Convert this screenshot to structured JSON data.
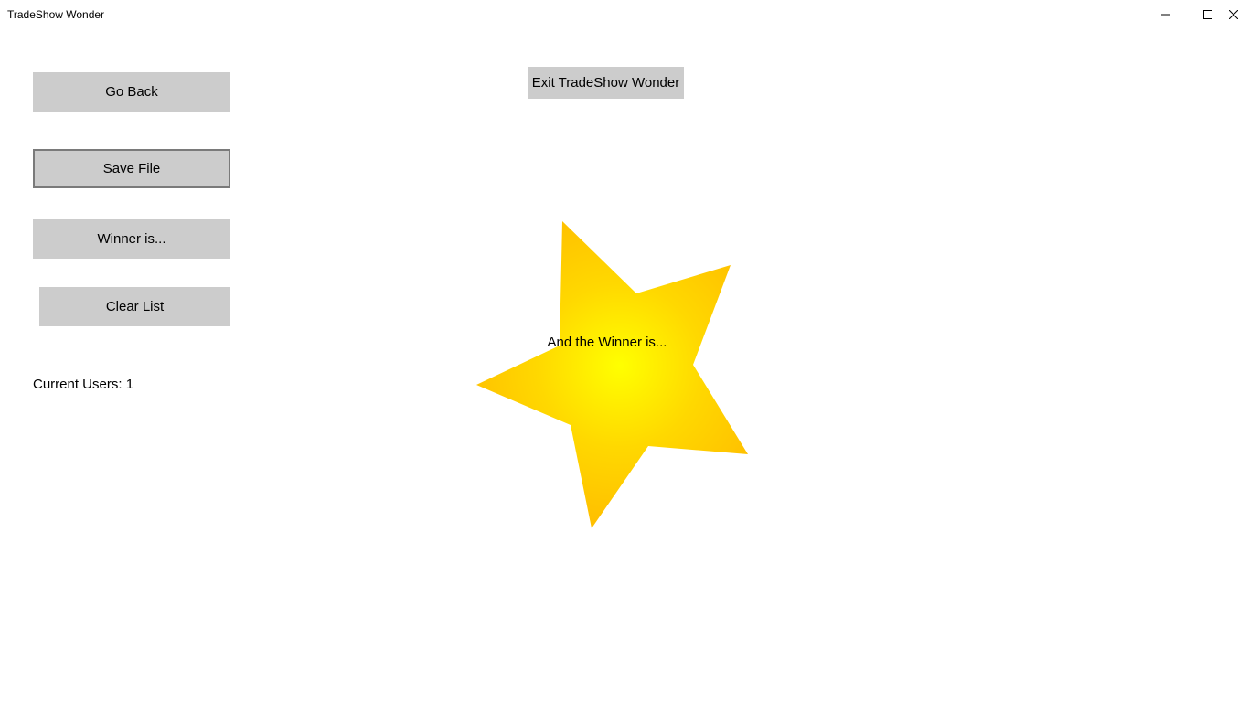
{
  "window": {
    "title": "TradeShow Wonder",
    "controls": {
      "minimize_icon": "minimize-icon",
      "maximize_icon": "maximize-icon",
      "close_icon": "close-icon"
    }
  },
  "sidebar": {
    "go_back_label": "Go Back",
    "save_file_label": "Save File",
    "winner_label": "Winner is...",
    "clear_list_label": "Clear List",
    "current_users_text": "Current Users: 1"
  },
  "main": {
    "exit_label": "Exit TradeShow Wonder",
    "star_text": "And the Winner is..."
  },
  "colors": {
    "button_bg": "#cccccc",
    "focus_border": "#7a7a7a",
    "star_center": "#ffff00",
    "star_edge": "#ffbf00"
  }
}
